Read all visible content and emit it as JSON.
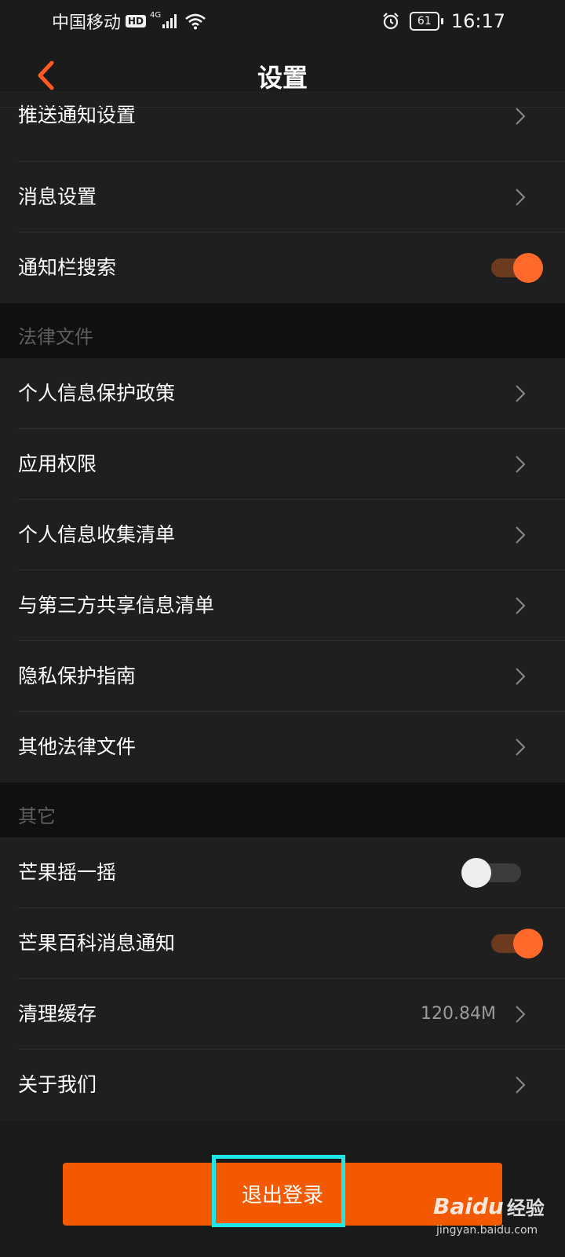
{
  "status_bar": {
    "carrier": "中国移动",
    "hd": "HD",
    "network": "4G",
    "battery": "61",
    "time": "16:17"
  },
  "header": {
    "title": "设置"
  },
  "rows_top": [
    {
      "label": "推送通知设置"
    },
    {
      "label": "消息设置"
    },
    {
      "label": "通知栏搜索"
    }
  ],
  "toggles": {
    "notification_bar_search": "on",
    "mango_shake": "off",
    "mango_wiki_notify": "on"
  },
  "sections": {
    "legal": "法律文件",
    "other": "其它"
  },
  "legal_items": [
    {
      "label": "个人信息保护政策"
    },
    {
      "label": "应用权限"
    },
    {
      "label": "个人信息收集清单"
    },
    {
      "label": "与第三方共享信息清单"
    },
    {
      "label": "隐私保护指南"
    },
    {
      "label": "其他法律文件"
    }
  ],
  "other_items": [
    {
      "label": "芒果摇一摇"
    },
    {
      "label": "芒果百科消息通知"
    },
    {
      "label": "清理缓存",
      "value": "120.84M"
    },
    {
      "label": "关于我们"
    }
  ],
  "logout": {
    "label": "退出登录"
  },
  "watermark": {
    "logo_text": "Baidu",
    "logo_cn": "经验",
    "url": "jingyan.baidu.com"
  },
  "colors": {
    "accent": "#f35a00",
    "toggle_on": "#ff6a2a",
    "highlight": "#1fe6e6"
  }
}
